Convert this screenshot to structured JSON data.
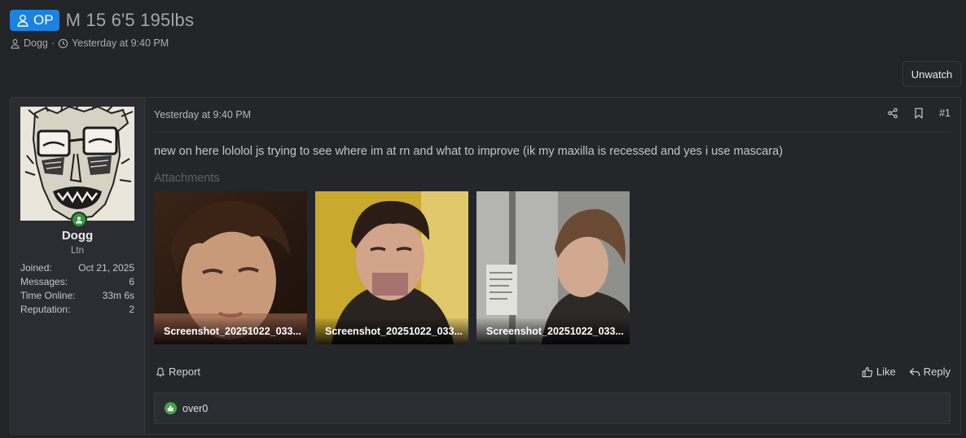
{
  "thread": {
    "prefix": "OP",
    "title": "M 15 6'5 195lbs",
    "author": "Dogg",
    "separator": "·",
    "date": "Yesterday at 9:40 PM"
  },
  "actions": {
    "unwatch": "Unwatch"
  },
  "post": {
    "user": {
      "name": "Dogg",
      "title": "Ltn",
      "stats": [
        {
          "label": "Joined:",
          "value": "Oct 21, 2025"
        },
        {
          "label": "Messages:",
          "value": "6"
        },
        {
          "label": "Time Online:",
          "value": "33m 6s"
        },
        {
          "label": "Reputation:",
          "value": "2"
        }
      ]
    },
    "date": "Yesterday at 9:40 PM",
    "number": "#1",
    "body": "new on here lololol js trying to see where im at rn and what to improve (ik my maxilla is recessed and yes i use mascara)",
    "attachments_label": "Attachments",
    "attachments": [
      {
        "filename": "Screenshot_20251022_033..."
      },
      {
        "filename": "Screenshot_20251022_033..."
      },
      {
        "filename": "Screenshot_20251022_033..."
      }
    ],
    "report": "Report",
    "like": "Like",
    "reply": "Reply",
    "reaction_user": "over0"
  },
  "colors": {
    "background": "#232428",
    "badge_blue": "#1a82e2",
    "online_green": "#2e9a3c",
    "like_green": "#3ea843"
  }
}
